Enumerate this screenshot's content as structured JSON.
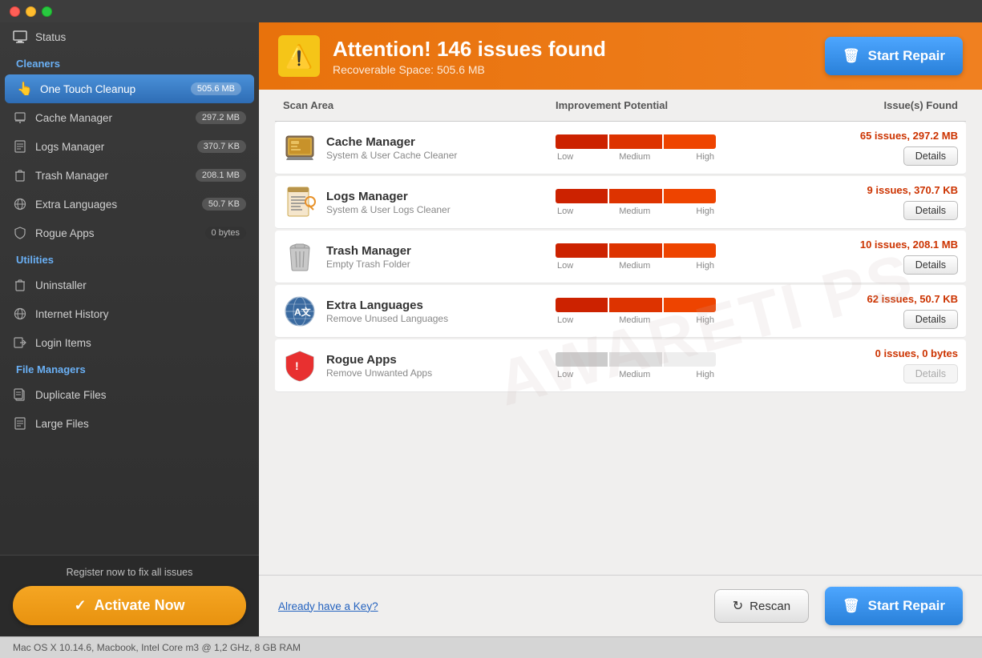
{
  "titlebar": {
    "buttons": [
      "close",
      "minimize",
      "maximize"
    ]
  },
  "sidebar": {
    "status_label": "Status",
    "sections": [
      {
        "label": "Cleaners",
        "items": [
          {
            "id": "one-touch-cleanup",
            "label": "One Touch Cleanup",
            "badge": "505.6 MB",
            "active": true,
            "icon": "hand"
          },
          {
            "id": "cache-manager",
            "label": "Cache Manager",
            "badge": "297.2 MB",
            "active": false,
            "icon": "cache"
          },
          {
            "id": "logs-manager",
            "label": "Logs Manager",
            "badge": "370.7 KB",
            "active": false,
            "icon": "logs"
          },
          {
            "id": "trash-manager",
            "label": "Trash Manager",
            "badge": "208.1 MB",
            "active": false,
            "icon": "trash"
          },
          {
            "id": "extra-languages",
            "label": "Extra Languages",
            "badge": "50.7 KB",
            "active": false,
            "icon": "globe"
          },
          {
            "id": "rogue-apps",
            "label": "Rogue Apps",
            "badge": "0 bytes",
            "active": false,
            "icon": "shield",
            "badge_dark": true
          }
        ]
      },
      {
        "label": "Utilities",
        "items": [
          {
            "id": "uninstaller",
            "label": "Uninstaller",
            "icon": "trash2"
          },
          {
            "id": "internet-history",
            "label": "Internet History",
            "icon": "globe"
          },
          {
            "id": "login-items",
            "label": "Login Items",
            "icon": "login"
          }
        ]
      },
      {
        "label": "File Managers",
        "items": [
          {
            "id": "duplicate-files",
            "label": "Duplicate Files",
            "icon": "files"
          },
          {
            "id": "large-files",
            "label": "Large Files",
            "icon": "largefile"
          }
        ]
      }
    ],
    "register_text": "Register now to fix all issues",
    "activate_label": "Activate Now"
  },
  "alert": {
    "title": "Attention! 146 issues found",
    "subtitle": "Recoverable Space: 505.6 MB",
    "start_repair_label": "Start Repair"
  },
  "table": {
    "headers": [
      "Scan Area",
      "Improvement Potential",
      "Issue(s) Found"
    ],
    "rows": [
      {
        "id": "cache-manager",
        "name": "Cache Manager",
        "desc": "System & User Cache Cleaner",
        "issues": "65 issues, 297.2 MB",
        "bar_active": true,
        "details_enabled": true
      },
      {
        "id": "logs-manager",
        "name": "Logs Manager",
        "desc": "System & User Logs Cleaner",
        "issues": "9 issues, 370.7 KB",
        "bar_active": true,
        "details_enabled": true
      },
      {
        "id": "trash-manager",
        "name": "Trash Manager",
        "desc": "Empty Trash Folder",
        "issues": "10 issues, 208.1 MB",
        "bar_active": true,
        "details_enabled": true
      },
      {
        "id": "extra-languages",
        "name": "Extra Languages",
        "desc": "Remove Unused Languages",
        "issues": "62 issues, 50.7 KB",
        "bar_active": true,
        "details_enabled": true
      },
      {
        "id": "rogue-apps",
        "name": "Rogue Apps",
        "desc": "Remove Unwanted Apps",
        "issues": "0 issues, 0 bytes",
        "bar_active": false,
        "details_enabled": false
      }
    ],
    "progress_labels": [
      "Low",
      "Medium",
      "High"
    ],
    "details_label": "Details"
  },
  "bottom": {
    "already_key_label": "Already have a Key?",
    "rescan_label": "Rescan",
    "start_repair_label": "Start Repair"
  },
  "status_bar": {
    "text": "Mac OS X 10.14.6, Macbook, Intel Core m3 @ 1,2 GHz, 8 GB RAM"
  },
  "watermark": "AWARETI PS"
}
